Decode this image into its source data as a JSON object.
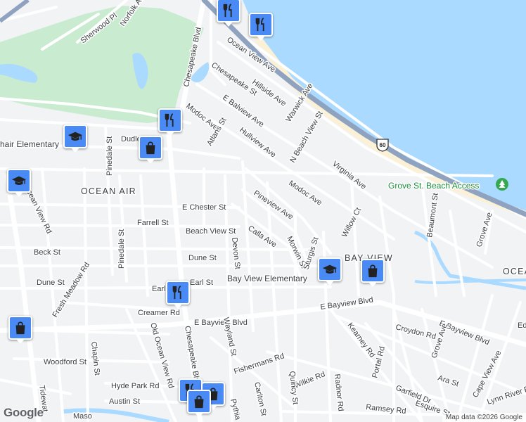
{
  "map": {
    "areas": {
      "ocean_air": "OCEAN AIR",
      "bay_view": "BAY VIEW",
      "ocean": "OCEA"
    },
    "pois": {
      "beach_access": "Grove St. Beach Access",
      "bay_view_elementary": "Bay View Elementary",
      "fair_elementary": "hair Elementary"
    },
    "streets": {
      "ocean_view_ave": "Ocean View Ave",
      "chesapeake_blvd_n": "Chesapeake Blvd",
      "chesapeake_blvd_s": "Chesapeake Blvd",
      "norfolk_ave": "Norfolk Ave",
      "sherwood_pl": "Sherwood Pl",
      "chesapeake_st": "Chesapeake St",
      "hillside_ave": "Hillside Ave",
      "warwick_ave": "Warwick Ave",
      "e_balview_ave": "E Balview Ave",
      "modoc_ave_w": "Modoc Ave",
      "modoc_ave_e": "Modoc Ave",
      "atlans_st": "Atlans St",
      "hullview_ave": "Hullview Ave",
      "n_beach_view_st": "N Beach View St",
      "virginia_ave": "Virginia Ave",
      "dudley": "Dudle",
      "pinedale_st_n": "Pinedale St",
      "pinedale_st_s": "Pinedale St",
      "e_chester_st": "E Chester St",
      "farrell_st": "Farrell St",
      "beach_view_st": "Beach View St",
      "pineview_ave": "Pineview Ave",
      "calla_ave": "Calla Ave",
      "willow_ct": "Willow Ct",
      "beaumont_st": "Beaumont St",
      "grove_ave_n": "Grove Ave",
      "grove_ave_s": "Grove Ave",
      "beck_st": "Beck St",
      "dune_st_w": "Dune St",
      "dune_st": "Dune St",
      "devon_st": "Devon St",
      "morwin_st": "Morwin St",
      "sturgis_st": "Sturgis St",
      "ocean_view_rd": "cean View Rd",
      "fresh_meadow_rd": "Fresh Meadow Rd",
      "earl_st_w": "Earl",
      "earl_st": "Earl St",
      "creamer_rd": "Creamer Rd",
      "e_bayview_blvd_w": "E Bayview Blvd",
      "e_bayview_blvd_c": "E Bayview Blvd",
      "e_bayview_blvd_e": "E Bayview Blvd",
      "croydon_rd": "Croydon Rd",
      "kearney_rd": "Kearney Rd",
      "portal_rd": "Portal Rd",
      "ara_st": "Ara St",
      "garfield_dr": "Garfield Dr",
      "cape_view_ave": "Cape View Ave",
      "lynn_river_rd": "Lynn River Rd",
      "esquire_st": "Esquire St",
      "edge": "Ed",
      "chapin_st": "Chapin St",
      "old_ocean_view_rd": "Old Ocean View Rd",
      "wayland_st": "Wayland St",
      "woodford_st": "Woodford St",
      "fishermans_rd": "Fishermans Rd",
      "wilkie_rd": "Wilkie Rd",
      "radnor_rd": "Radnor Rd",
      "quincy_st": "Quincy St",
      "carlton_st": "Carlton St",
      "pythian": "Pythia",
      "hyde_park_rd": "Hyde Park Rd",
      "austin_st": "Austin St",
      "tidewater": "Tidewat",
      "ramsey_rd": "Ramsey Rd",
      "mason": "Maso"
    },
    "route_shield": "60",
    "markers": [
      {
        "type": "restaurant",
        "icon": "fork-knife-icon"
      },
      {
        "type": "restaurant",
        "icon": "fork-knife-icon"
      },
      {
        "type": "restaurant",
        "icon": "fork-knife-icon"
      },
      {
        "type": "school",
        "icon": "graduation-cap-icon"
      },
      {
        "type": "shopping",
        "icon": "shopping-bag-icon"
      },
      {
        "type": "school",
        "icon": "graduation-cap-icon"
      },
      {
        "type": "school",
        "icon": "graduation-cap-icon"
      },
      {
        "type": "shopping",
        "icon": "shopping-bag-icon"
      },
      {
        "type": "restaurant",
        "icon": "fork-knife-icon"
      },
      {
        "type": "shopping",
        "icon": "shopping-bag-icon"
      },
      {
        "type": "restaurant",
        "icon": "fork-knife-icon"
      },
      {
        "type": "shopping",
        "icon": "shopping-bag-icon"
      },
      {
        "type": "shopping",
        "icon": "shopping-bag-icon"
      }
    ],
    "colors": {
      "water": "#aadaff",
      "park": "#c9ebd0",
      "land": "#f1f3f4",
      "highway": "#8fa3c1",
      "marker": "#4a8af4",
      "beach": "#faf1d7"
    }
  },
  "footer": {
    "logo": "Google",
    "attribution": "Map data ©2026 Google"
  }
}
